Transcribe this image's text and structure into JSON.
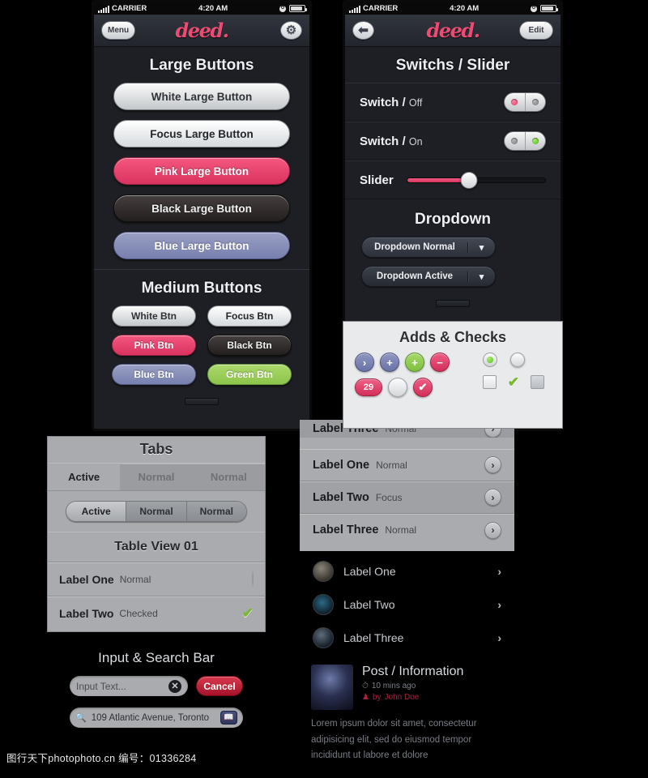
{
  "statusbar": {
    "carrier": "CARRIER",
    "time": "4:20 AM",
    "signal_icon": "signal-bars-icon",
    "battery_icon": "battery-icon"
  },
  "brand": "deed.",
  "phone_left": {
    "nav": {
      "menu_label": "Menu",
      "gear_icon": "gear-icon"
    },
    "large_section": {
      "title": "Large Buttons",
      "buttons": [
        {
          "label": "White Large Button",
          "style": "b-white"
        },
        {
          "label": "Focus Large Button",
          "style": "b-focus"
        },
        {
          "label": "Pink Large Button",
          "style": "b-pink"
        },
        {
          "label": "Black Large Button",
          "style": "b-black"
        },
        {
          "label": "Blue Large Button",
          "style": "b-blue"
        }
      ]
    },
    "medium_section": {
      "title": "Medium Buttons",
      "buttons": [
        {
          "label": "White Btn",
          "style": "b-white"
        },
        {
          "label": "Focus Btn",
          "style": "b-focus"
        },
        {
          "label": "Pink Btn",
          "style": "b-pink"
        },
        {
          "label": "Black Btn",
          "style": "b-black"
        },
        {
          "label": "Blue Btn",
          "style": "b-blue"
        },
        {
          "label": "Green Btn",
          "style": "b-green"
        }
      ]
    }
  },
  "phone_right": {
    "nav": {
      "back_icon": "back-arrow-icon",
      "edit_label": "Edit"
    },
    "switch_section": {
      "title": "Switchs / Slider",
      "rows": [
        {
          "label": "Switch /",
          "state": "Off"
        },
        {
          "label": "Switch /",
          "state": "On"
        }
      ],
      "slider_label": "Slider",
      "slider_value": 45
    },
    "dropdown_section": {
      "title": "Dropdown",
      "items": [
        {
          "label": "Dropdown Normal",
          "chevron": "chevron-down-icon"
        },
        {
          "label": "Dropdown Active",
          "chevron": "chevron-down-icon"
        }
      ]
    },
    "adds_section": {
      "title": "Adds & Checks",
      "actions": [
        {
          "glyph": "›",
          "icon": "chevron-right-circle-icon",
          "style": "c-blue"
        },
        {
          "glyph": "+",
          "icon": "plus-circle-blue-icon",
          "style": "c-blue"
        },
        {
          "glyph": "+",
          "icon": "plus-circle-green-icon",
          "style": "c-green"
        },
        {
          "glyph": "−",
          "icon": "minus-circle-icon",
          "style": "c-pink"
        }
      ],
      "badge": "29",
      "blank_icon": "blank-circle-icon",
      "check_glyph": "✔",
      "check_icon": "check-circle-icon",
      "radio_selected_icon": "radio-selected-icon",
      "radio_empty_icon": "radio-empty-icon",
      "checkbox_empty_icon": "checkbox-empty-icon",
      "checkbox_checked_glyph": "✔",
      "checkbox_checked_icon": "checkbox-checked-icon",
      "checkbox_disabled_icon": "checkbox-disabled-icon"
    }
  },
  "tabs_card": {
    "title": "Tabs",
    "tabs": [
      {
        "label": "Active",
        "state": "active"
      },
      {
        "label": "Normal",
        "state": "normal"
      },
      {
        "label": "Normal",
        "state": "normal"
      }
    ],
    "segments": [
      {
        "label": "Active",
        "state": "active"
      },
      {
        "label": "Normal",
        "state": "normal"
      },
      {
        "label": "Normal",
        "state": "normal"
      }
    ],
    "table_title": "Table View 01",
    "rows": [
      {
        "label": "Label One",
        "sub": "Normal",
        "accessory": "radio-empty-icon"
      },
      {
        "label": "Label Two",
        "sub": "Checked",
        "accessory": "check-icon"
      }
    ]
  },
  "input_section": {
    "title": "Input & Search Bar",
    "input_placeholder": "Input Text...",
    "clear_icon": "clear-circle-icon",
    "cancel_label": "Cancel",
    "search_icon": "search-icon",
    "search_value": "109 Atlantic Avenue, Toronto",
    "bookmark_icon": "bookmark-book-icon"
  },
  "labels_card": {
    "cut_row": {
      "label": "Label Three",
      "sub": "Normal"
    },
    "rows": [
      {
        "label": "Label One",
        "sub": "Normal",
        "chevron": "chevron-right-icon"
      },
      {
        "label": "Label Two",
        "sub": "Focus",
        "chevron": "chevron-right-icon"
      },
      {
        "label": "Label Three",
        "sub": "Normal",
        "chevron": "chevron-right-icon"
      }
    ]
  },
  "dark_list": {
    "rows": [
      {
        "label": "Label One",
        "avatar": "avatar-one",
        "chevron": "chevron-right-icon"
      },
      {
        "label": "Label Two",
        "avatar": "avatar-two",
        "chevron": "chevron-right-icon"
      },
      {
        "label": "Label Three",
        "avatar": "avatar-three",
        "chevron": "chevron-right-icon"
      }
    ]
  },
  "post": {
    "title": "Post / Information",
    "clock_icon": "clock-icon",
    "time": "10 mins ago",
    "person_icon": "person-icon",
    "by_label": "by",
    "author": "John Doe",
    "body": "Lorem ipsum dolor sit amet, consectetur adipisicing elit, sed do eiusmod tempor incididunt ut labore et dolore",
    "avatar_icon": "post-avatar"
  },
  "watermark": "图行天下photophoto.cn  编号：01336284",
  "colors": {
    "pink": "#ec4b74",
    "green": "#8cc44a",
    "blue": "#777fae",
    "red": "#a5132a"
  }
}
